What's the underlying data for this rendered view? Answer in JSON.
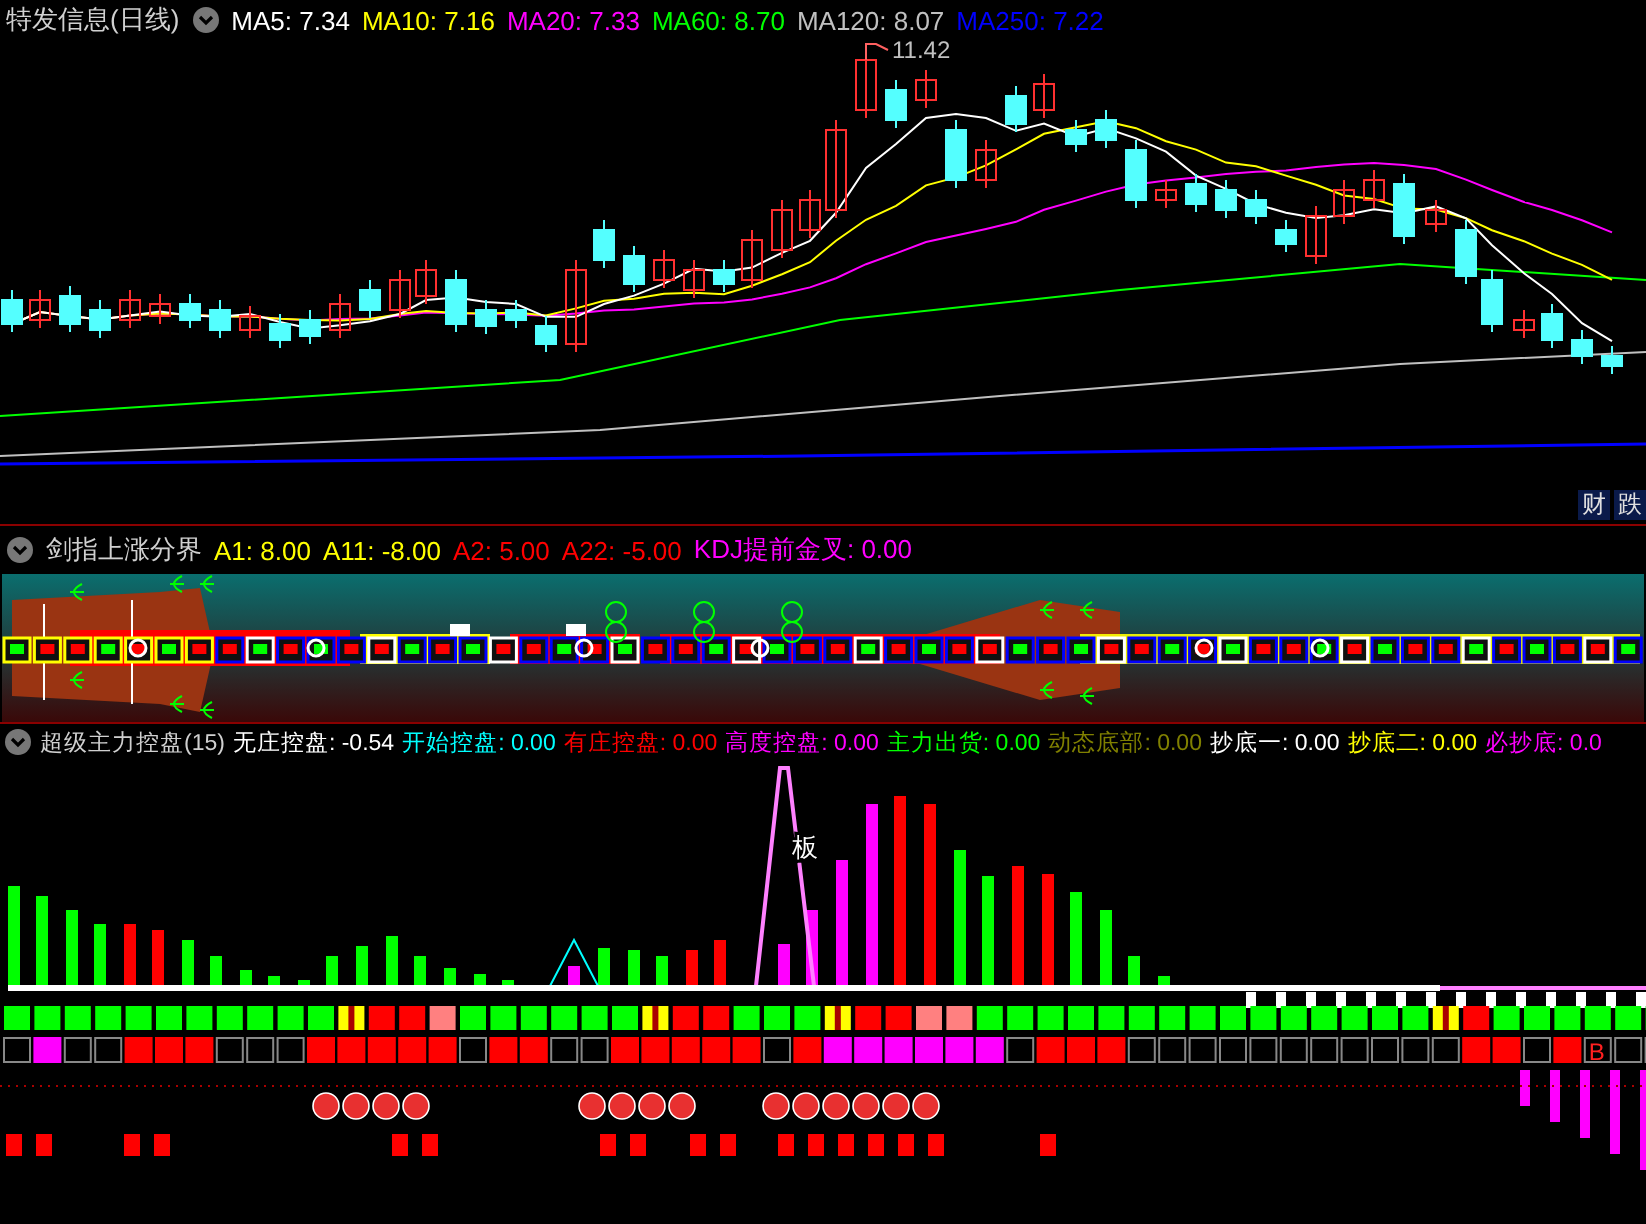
{
  "panels": [
    {
      "title": "特发信息(日线)",
      "legend": [
        {
          "label": "MA5:",
          "value": "7.34",
          "color": "#ffffff"
        },
        {
          "label": "MA10:",
          "value": "7.16",
          "color": "#ffff00"
        },
        {
          "label": "MA20:",
          "value": "7.33",
          "color": "#ff00ff"
        },
        {
          "label": "MA60:",
          "value": "8.70",
          "color": "#00ff00"
        },
        {
          "label": "MA120:",
          "value": "8.07",
          "color": "#c0c0c0"
        },
        {
          "label": "MA250:",
          "value": "7.22",
          "color": "#0000ff"
        }
      ],
      "high_label": "11.42",
      "buttons": [
        "财",
        "跌"
      ]
    },
    {
      "title": "剑指上涨分界",
      "legend": [
        {
          "label": "A1:",
          "value": "8.00",
          "color": "#ffff00"
        },
        {
          "label": "A11:",
          "value": "-8.00",
          "color": "#ffff00"
        },
        {
          "label": "A2:",
          "value": "5.00",
          "color": "#ff0000"
        },
        {
          "label": "A22:",
          "value": "-5.00",
          "color": "#ff0000"
        },
        {
          "label": "KDJ提前金叉:",
          "value": "0.00",
          "color": "#ff00ff"
        }
      ]
    },
    {
      "title": "超级主力控盘(15)",
      "legend": [
        {
          "label": "无庄控盘:",
          "value": "-0.54",
          "color": "#ffffff"
        },
        {
          "label": "开始控盘:",
          "value": "0.00",
          "color": "#00ffff"
        },
        {
          "label": "有庄控盘:",
          "value": "0.00",
          "color": "#ff0000"
        },
        {
          "label": "高度控盘:",
          "value": "0.00",
          "color": "#ff00ff"
        },
        {
          "label": "主力出货:",
          "value": "0.00",
          "color": "#00ff00"
        },
        {
          "label": "动态底部:",
          "value": "0.00",
          "color": "#808000"
        },
        {
          "label": "抄底一:",
          "value": "0.00",
          "color": "#ffffff"
        },
        {
          "label": "抄底二:",
          "value": "0.00",
          "color": "#ffff00"
        },
        {
          "label": "必抄底:",
          "value": "0.0",
          "color": "#ff00ff"
        }
      ],
      "peak_label": "板",
      "box_label": "B"
    }
  ]
}
